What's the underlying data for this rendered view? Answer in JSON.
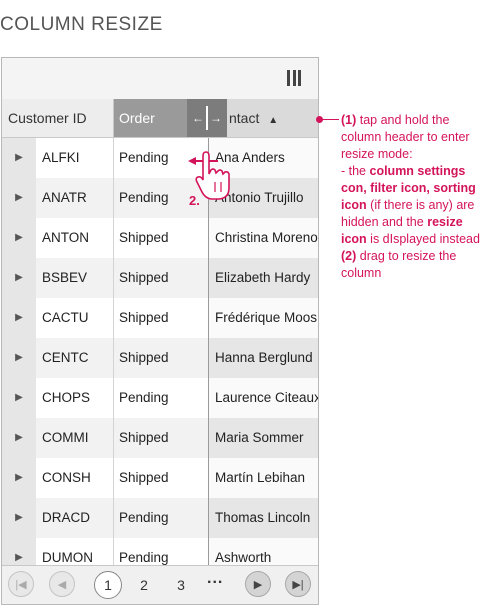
{
  "page_title": "COLUMN RESIZE",
  "toolbar": {
    "column_settings_icon": "columns-icon"
  },
  "header": {
    "customer_id": "Customer ID",
    "order": "Order",
    "contact": "ntact",
    "sort_arrow": "▲",
    "resize_icon": "resize-icon"
  },
  "rows": [
    {
      "id": "ALFKI",
      "order": "Pending",
      "contact": "Ana Anders"
    },
    {
      "id": "ANATR",
      "order": "Pending",
      "contact": "Antonio Trujillo"
    },
    {
      "id": "ANTON",
      "order": "Shipped",
      "contact": "Christina Moreno"
    },
    {
      "id": "BSBEV",
      "order": "Shipped",
      "contact": "Elizabeth Hardy"
    },
    {
      "id": "CACTU",
      "order": "Shipped",
      "contact": "Frédérique Moos"
    },
    {
      "id": "CENTC",
      "order": "Shipped",
      "contact": "Hanna Berglund"
    },
    {
      "id": "CHOPS",
      "order": "Pending",
      "contact": "Laurence Citeaux"
    },
    {
      "id": "COMMI",
      "order": "Shipped",
      "contact": "Maria Sommer"
    },
    {
      "id": "CONSH",
      "order": "Shipped",
      "contact": "Martín Lebihan"
    },
    {
      "id": "DRACD",
      "order": "Pending",
      "contact": "Thomas Lincoln"
    },
    {
      "id": "DUMON",
      "order": "Pending",
      "contact": "Ashworth"
    }
  ],
  "expander_glyph": "▶",
  "pager": {
    "first": "|◀",
    "prev": "◀",
    "page1": "1",
    "page2": "2",
    "page3": "3",
    "dots": "...",
    "next": "▶",
    "last": "▶|"
  },
  "annotation": {
    "p1_label": "(1)",
    "p1_text_a": " tap and hold the column header to enter resize mode:",
    "dash": "- the ",
    "b1": "column settings con, filter icon, sorting icon",
    "mid": " (if there is any) are hidden and the ",
    "b2": "resize icon",
    "end": " is dIsplayed instead",
    "p2_label": "(2)",
    "p2_text": " drag to resize the column",
    "step2": "2."
  },
  "colors": {
    "accent": "#d4145a",
    "header_active": "#9a9a9a",
    "resize_bg": "#7c7c7c"
  }
}
